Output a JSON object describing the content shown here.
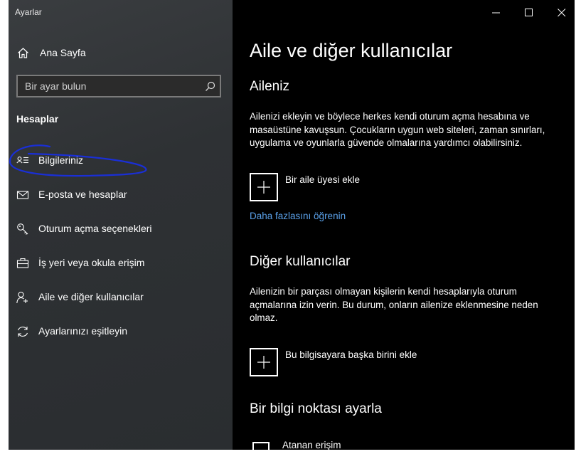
{
  "window": {
    "title": "Ayarlar"
  },
  "sidebar": {
    "home_label": "Ana Sayfa",
    "search_placeholder": "Bir ayar bulun",
    "section_title": "Hesaplar",
    "items": [
      {
        "label": "Bilgileriniz",
        "icon": "person-card-icon",
        "annotated": true
      },
      {
        "label": "E-posta ve hesaplar",
        "icon": "mail-icon"
      },
      {
        "label": "Oturum açma seçenekleri",
        "icon": "key-icon"
      },
      {
        "label": "İş yeri veya okula erişim",
        "icon": "briefcase-icon"
      },
      {
        "label": "Aile ve diğer kullanıcılar",
        "icon": "add-person-icon"
      },
      {
        "label": "Ayarlarınızı eşitleyin",
        "icon": "sync-icon"
      }
    ]
  },
  "content": {
    "title": "Aile ve diğer kullanıcılar",
    "family": {
      "heading": "Aileniz",
      "description": "Ailenizi ekleyin ve böylece herkes kendi oturum açma hesabına ve masaüstüne kavuşsun. Çocukların uygun web siteleri, zaman sınırları, uygulama ve oyunlarla güvende olmalarına yardımcı olabilirsiniz.",
      "add_label": "Bir aile üyesi ekle",
      "learn_more": "Daha fazlasını öğrenin"
    },
    "others": {
      "heading": "Diğer kullanıcılar",
      "description": "Ailenizin bir parçası olmayan kişilerin kendi hesaplarıyla oturum açmalarına izin verin. Bu durum, onların ailenize eklenmesine neden olmaz.",
      "add_label": "Bu bilgisayara başka birini ekle"
    },
    "kiosk": {
      "heading": "Bir bilgi noktası ayarla",
      "assigned_access": "Atanan erişim"
    }
  },
  "colors": {
    "link": "#5aa0e8",
    "annotation": "#1a2fd6"
  }
}
